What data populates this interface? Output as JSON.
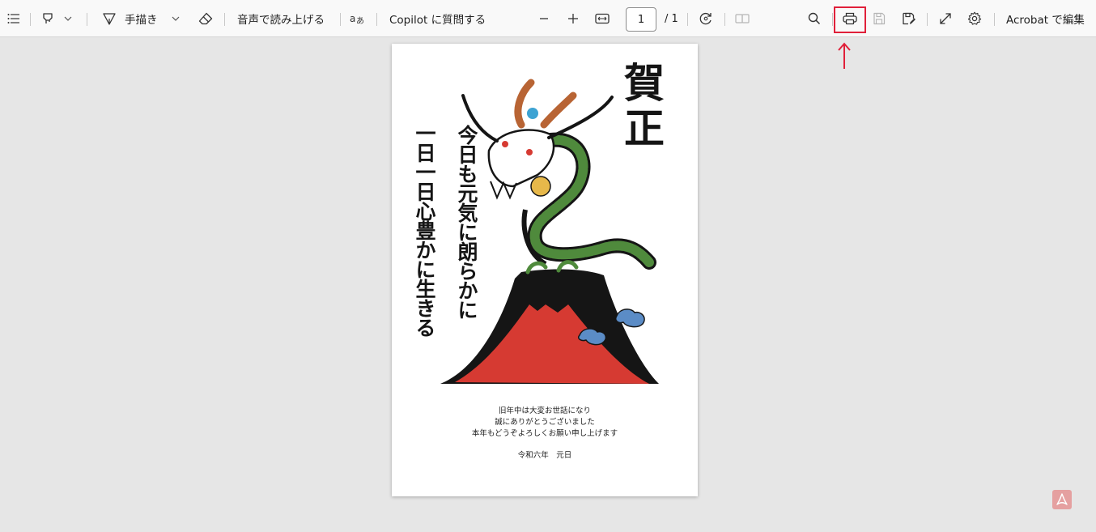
{
  "toolbar": {
    "handwrite_label": "手描き",
    "read_aloud_label": "音声で読み上げる",
    "copilot_label": "Copilot に質問する",
    "page_number": "1",
    "page_total": "/ 1",
    "edit_in_acrobat_label": "Acrobat で編集"
  },
  "icons": {
    "contents": "list-icon",
    "highlight": "highlighter-icon",
    "dropdown": "chevron-down-icon",
    "draw": "pen-icon",
    "erase": "eraser-icon",
    "text_options": "text-options-icon",
    "zoom_out": "minus-icon",
    "zoom_in": "plus-icon",
    "fit": "fit-width-icon",
    "rotate": "rotate-icon",
    "page_view": "two-page-icon",
    "search": "search-icon",
    "print": "print-icon",
    "save": "save-icon",
    "save_as": "save-as-icon",
    "fullscreen": "fullscreen-icon",
    "settings": "gear-icon",
    "app_logo": "acrobat-logo"
  },
  "annotation": {
    "highlight_color": "#e0203a",
    "arrow_color": "#e0203a"
  },
  "document": {
    "title": "賀正",
    "motto_line1": "今日も元気に朗らかに",
    "motto_line2": "一日一日心豊かに生きる",
    "greeting_line1": "旧年中は大変お世話になり",
    "greeting_line2": "誠にありがとうございました",
    "greeting_line3": "本年もどうぞよろしくお願い申し上げます",
    "date": "令和六年　元日",
    "colors": {
      "mountain_red": "#d63a32",
      "dragon_green": "#4f8a3c",
      "ink": "#151515",
      "cloud_blue": "#5b8cc6",
      "jewel_gold": "#e7b84a"
    }
  }
}
